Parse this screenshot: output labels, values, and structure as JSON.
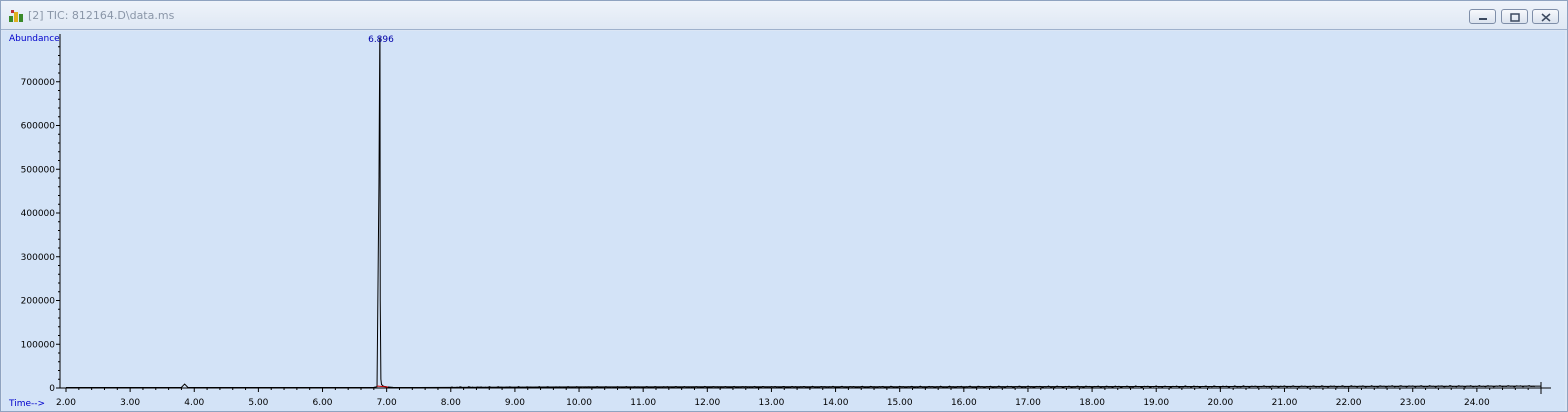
{
  "window": {
    "title": "[2] TIC: 812164.D\\data.ms",
    "buttons": [
      "minimize",
      "restore",
      "close"
    ]
  },
  "colors": {
    "plot_background": "#d3e3f7",
    "axis_label": "#0000cc",
    "trace": "#000000",
    "peak_label": "#0000aa",
    "baseline_marker": "#cc0000"
  },
  "chart_data": {
    "type": "line",
    "ylabel": "Abundance",
    "xlabel": "Time-->",
    "xlim": [
      2.0,
      25.0
    ],
    "ylim": [
      0,
      800000
    ],
    "xticks": [
      "2.00",
      "3.00",
      "4.00",
      "5.00",
      "6.00",
      "7.00",
      "8.00",
      "9.00",
      "10.00",
      "11.00",
      "12.00",
      "13.00",
      "14.00",
      "15.00",
      "16.00",
      "17.00",
      "18.00",
      "19.00",
      "20.00",
      "21.00",
      "22.00",
      "23.00",
      "24.00"
    ],
    "yticks": [
      "0",
      "100000",
      "200000",
      "300000",
      "400000",
      "500000",
      "600000",
      "700000"
    ],
    "peak_labels": [
      {
        "time": 6.896,
        "label": "6.896"
      }
    ],
    "series": [
      {
        "x": [
          2.0,
          3.0,
          3.8,
          3.85,
          3.9,
          4.0,
          5.0,
          6.0,
          6.8,
          6.85,
          6.88,
          6.893,
          6.896,
          6.9,
          6.91,
          6.92,
          6.95,
          7.0,
          7.1,
          7.5,
          8.0,
          9.0,
          10.0,
          12.0,
          14.0,
          16.0,
          18.0,
          20.0,
          22.0,
          24.0,
          24.5,
          25.0
        ],
        "y": [
          1000,
          1200,
          1500,
          9000,
          1500,
          1200,
          1000,
          1000,
          1500,
          3000,
          470000,
          800000,
          800000,
          200000,
          20000,
          8000,
          4000,
          2500,
          1500,
          1000,
          1500,
          2000,
          2500,
          2800,
          3000,
          3000,
          3200,
          3500,
          3800,
          4000,
          4200,
          4200
        ]
      }
    ],
    "grid": false
  }
}
